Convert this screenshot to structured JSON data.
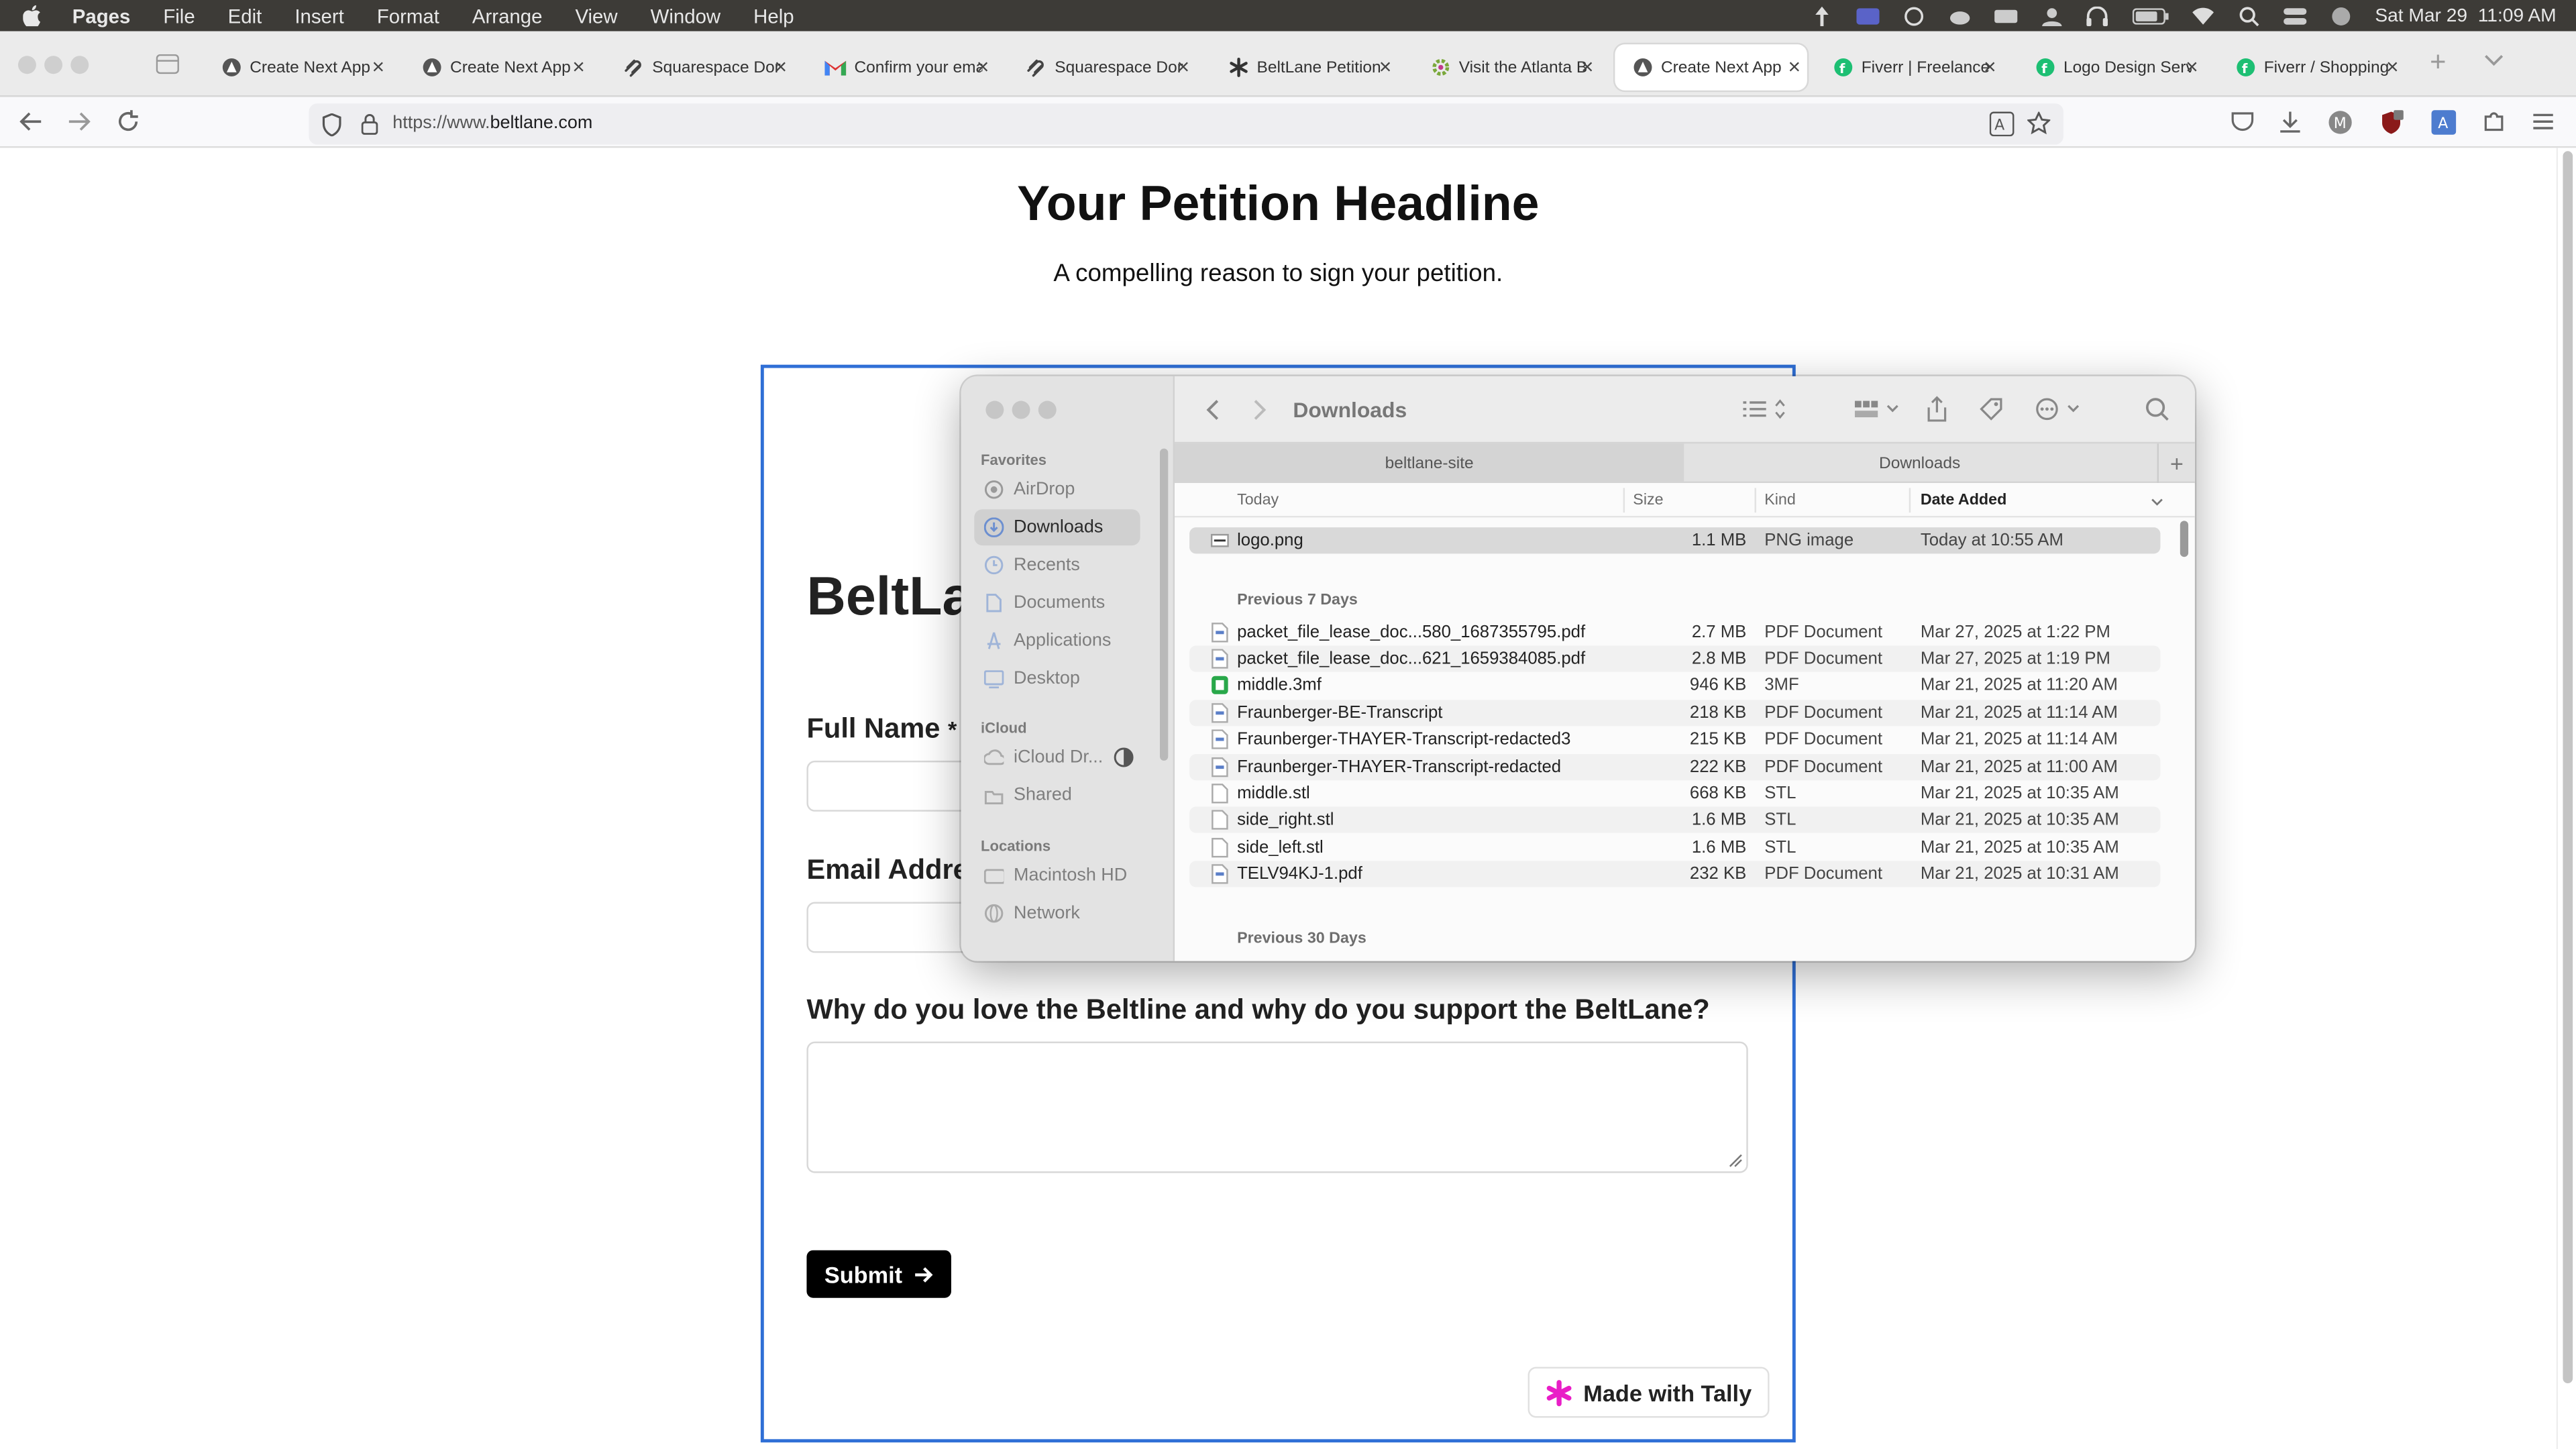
{
  "menubar": {
    "app": "Pages",
    "items": [
      "File",
      "Edit",
      "Insert",
      "Format",
      "Arrange",
      "View",
      "Window",
      "Help"
    ],
    "datetime": "Sat Mar 29  11:09 AM"
  },
  "tabs": [
    {
      "title": "Create Next App",
      "icon": "nextjs-icon"
    },
    {
      "title": "Create Next App",
      "icon": "nextjs-icon"
    },
    {
      "title": "Squarespace Dom",
      "icon": "squarespace-icon"
    },
    {
      "title": "Confirm your ema",
      "icon": "gmail-icon"
    },
    {
      "title": "Squarespace Dom",
      "icon": "squarespace-icon"
    },
    {
      "title": "BeltLane Petition",
      "icon": "tally-icon"
    },
    {
      "title": "Visit the Atlanta B",
      "icon": "atlanta-icon"
    },
    {
      "title": "Create Next App",
      "icon": "nextjs-icon",
      "active": true
    },
    {
      "title": "Fiverr | Freelance",
      "icon": "fiverr-icon"
    },
    {
      "title": "Logo Design Serv",
      "icon": "fiverr-icon"
    },
    {
      "title": "Fiverr / Shopping",
      "icon": "fiverr-icon"
    }
  ],
  "url": {
    "prefix": "https://www.",
    "domain": "beltlane.com"
  },
  "page": {
    "headline": "Your Petition Headline",
    "subhead": "A compelling reason to sign your petition.",
    "brand": "BeltLa",
    "full_name_label": "Full Name",
    "required_mark": "*",
    "email_label": "Email Addre",
    "why_label": "Why do you love the Beltline and why do you support the BeltLane?",
    "submit_label": "Submit",
    "tally_label": "Made with Tally"
  },
  "finder": {
    "title": "Downloads",
    "favorites_head": "Favorites",
    "favorites": [
      "AirDrop",
      "Downloads",
      "Recents",
      "Documents",
      "Applications",
      "Desktop"
    ],
    "icloud_head": "iCloud",
    "icloud": [
      "iCloud Dr...",
      "Shared"
    ],
    "locations_head": "Locations",
    "locations": [
      "Macintosh HD",
      "Network"
    ],
    "tabs": [
      "beltlane-site",
      "Downloads"
    ],
    "columns": {
      "name": "Today",
      "size": "Size",
      "kind": "Kind",
      "date": "Date Added"
    },
    "section_prev7": "Previous 7 Days",
    "section_prev30": "Previous 30 Days",
    "today_files": [
      {
        "name": "logo.png",
        "size": "1.1 MB",
        "kind": "PNG image",
        "date": "Today at 10:55 AM"
      }
    ],
    "files": [
      {
        "name": "packet_file_lease_doc...580_1687355795.pdf",
        "size": "2.7 MB",
        "kind": "PDF Document",
        "date": "Mar 27, 2025 at 1:22 PM"
      },
      {
        "name": "packet_file_lease_doc...621_1659384085.pdf",
        "size": "2.8 MB",
        "kind": "PDF Document",
        "date": "Mar 27, 2025 at 1:19 PM"
      },
      {
        "name": "middle.3mf",
        "size": "946 KB",
        "kind": "3MF",
        "date": "Mar 21, 2025 at 11:20 AM"
      },
      {
        "name": "Fraunberger-BE-Transcript",
        "size": "218 KB",
        "kind": "PDF Document",
        "date": "Mar 21, 2025 at 11:14 AM"
      },
      {
        "name": "Fraunberger-THAYER-Transcript-redacted3",
        "size": "215 KB",
        "kind": "PDF Document",
        "date": "Mar 21, 2025 at 11:14 AM"
      },
      {
        "name": "Fraunberger-THAYER-Transcript-redacted",
        "size": "222 KB",
        "kind": "PDF Document",
        "date": "Mar 21, 2025 at 11:00 AM"
      },
      {
        "name": "middle.stl",
        "size": "668 KB",
        "kind": "STL",
        "date": "Mar 21, 2025 at 10:35 AM"
      },
      {
        "name": "side_right.stl",
        "size": "1.6 MB",
        "kind": "STL",
        "date": "Mar 21, 2025 at 10:35 AM"
      },
      {
        "name": "side_left.stl",
        "size": "1.6 MB",
        "kind": "STL",
        "date": "Mar 21, 2025 at 10:35 AM"
      },
      {
        "name": "TELV94KJ-1.pdf",
        "size": "232 KB",
        "kind": "PDF Document",
        "date": "Mar 21, 2025 at 10:31 AM"
      }
    ]
  },
  "colors": {
    "form_border": "#2f6fd6",
    "tally_pink": "#e91ec7",
    "submit_bg": "#000000",
    "fiverr_green": "#1dbf73"
  }
}
